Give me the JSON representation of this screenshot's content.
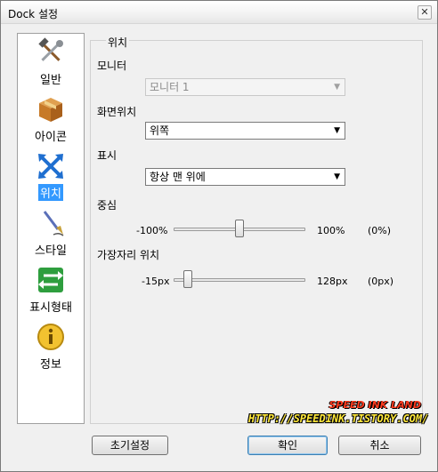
{
  "window": {
    "title": "Dock 설정",
    "close_glyph": "✕"
  },
  "sidebar": {
    "items": [
      {
        "label": "일반",
        "icon": "hammer-wrench-icon",
        "selected": false
      },
      {
        "label": "아이콘",
        "icon": "box-icon",
        "selected": false
      },
      {
        "label": "위치",
        "icon": "arrows-icon",
        "selected": true
      },
      {
        "label": "스타일",
        "icon": "brush-icon",
        "selected": false
      },
      {
        "label": "표시형태",
        "icon": "swap-arrows-icon",
        "selected": false
      },
      {
        "label": "정보",
        "icon": "info-icon",
        "selected": false
      }
    ]
  },
  "panel": {
    "title": "위치",
    "monitor": {
      "label": "모니터",
      "value": "모니터 1",
      "disabled": true
    },
    "screen_position": {
      "label": "화면위치",
      "value": "위쪽"
    },
    "display": {
      "label": "표시",
      "value": "항상 맨 위에"
    },
    "center": {
      "label": "중심",
      "min": "-100%",
      "max": "100%",
      "current": "(0%)",
      "value_fraction": 0.5
    },
    "edge_position": {
      "label": "가장자리 위치",
      "min": "-15px",
      "max": "128px",
      "current": "(0px)",
      "value_fraction": 0.105
    }
  },
  "watermark": {
    "line1": "SPEED INK LAND",
    "line2": "HTTP://SPEEDINK.TISTORY.COM/"
  },
  "buttons": {
    "reset": "초기설정",
    "ok": "확인",
    "cancel": "취소"
  }
}
